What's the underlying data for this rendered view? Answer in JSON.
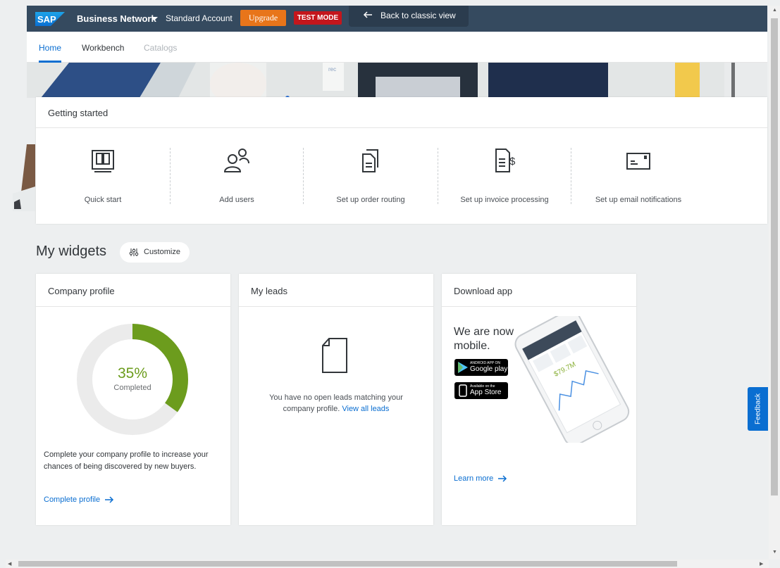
{
  "topbar": {
    "logo": "SAP",
    "title": "Business Network",
    "account": "Standard Account",
    "upgrade_label": "Upgrade",
    "test_mode_label": "TEST MODE",
    "classic_label": "Back to classic view",
    "bg_color": "#354a5f"
  },
  "tabs": [
    {
      "label": "Home",
      "state": "active"
    },
    {
      "label": "Workbench",
      "state": "normal"
    },
    {
      "label": "Catalogs",
      "state": "disabled"
    }
  ],
  "getting_started": {
    "title": "Getting started",
    "items": [
      {
        "label": "Quick start",
        "icon": "book-icon"
      },
      {
        "label": "Add users",
        "icon": "users-icon"
      },
      {
        "label": "Set up order routing",
        "icon": "documents-icon"
      },
      {
        "label": "Set up invoice processing",
        "icon": "invoice-icon"
      },
      {
        "label": "Set up email notifications",
        "icon": "envelope-icon"
      }
    ]
  },
  "widgets": {
    "title": "My widgets",
    "customize_label": "Customize",
    "company_profile": {
      "title": "Company profile",
      "percent_text": "35%",
      "percent_value": 0.35,
      "completed_label": "Completed",
      "description": "Complete your company profile to increase your chances of being discovered by new buyers.",
      "link": "Complete profile",
      "accent_color": "#6c9c1d"
    },
    "my_leads": {
      "title": "My leads",
      "message": "You have no open leads matching your company profile.",
      "link": "View all leads"
    },
    "download_app": {
      "title": "Download app",
      "headline": "We are now mobile.",
      "google_play_small": "ANDROID APP ON",
      "google_play": "Google play",
      "app_store_small": "Available on the",
      "app_store": "App Store",
      "phone_stat": "$79.7M",
      "link": "Learn more"
    }
  },
  "feedback_label": "Feedback"
}
